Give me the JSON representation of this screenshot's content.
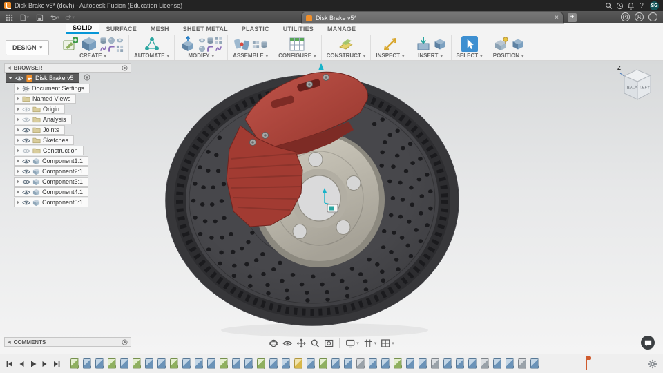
{
  "title_bar": {
    "title": "Disk Brake v5* (dcvh) - Autodesk Fusion (Education License)",
    "avatar_initials": "SG"
  },
  "tab_bar": {
    "document_tab": "Disk Brake v5*",
    "new_tab_label": "+",
    "close_label": "×"
  },
  "ribbon": {
    "workspace_label": "DESIGN",
    "active_tab": "SOLID",
    "tabs": [
      "SOLID",
      "SURFACE",
      "MESH",
      "SHEET METAL",
      "PLASTIC",
      "UTILITIES",
      "MANAGE"
    ],
    "groups": [
      "CREATE",
      "AUTOMATE",
      "MODIFY",
      "ASSEMBLE",
      "CONFIGURE",
      "CONSTRUCT",
      "INSPECT",
      "INSERT",
      "SELECT",
      "POSITION"
    ]
  },
  "browser": {
    "header": "BROWSER",
    "root_label": "Disk Brake v5",
    "items": [
      {
        "label": "Document Settings",
        "icon": "gear",
        "eye": "none"
      },
      {
        "label": "Named Views",
        "icon": "folder",
        "eye": "none"
      },
      {
        "label": "Origin",
        "icon": "folder",
        "eye": "off"
      },
      {
        "label": "Analysis",
        "icon": "folder",
        "eye": "off"
      },
      {
        "label": "Joints",
        "icon": "folder",
        "eye": "on"
      },
      {
        "label": "Sketches",
        "icon": "folder",
        "eye": "on"
      },
      {
        "label": "Construction",
        "icon": "folder",
        "eye": "off"
      },
      {
        "label": "Component1:1",
        "icon": "component",
        "eye": "on"
      },
      {
        "label": "Component2:1",
        "icon": "component",
        "eye": "on"
      },
      {
        "label": "Component3:1",
        "icon": "component",
        "eye": "on"
      },
      {
        "label": "Component4:1",
        "icon": "component",
        "eye": "on"
      },
      {
        "label": "Component5:1",
        "icon": "component",
        "eye": "on"
      }
    ]
  },
  "viewcube": {
    "visible_faces": [
      "BACK",
      "LEFT"
    ],
    "axis_label": "Z"
  },
  "comments_panel": {
    "header": "COMMENTS"
  },
  "timeline": {
    "features": [
      "sketch",
      "feature",
      "feature",
      "sketch",
      "feature",
      "sketch",
      "feature",
      "feature",
      "sketch",
      "feature",
      "feature",
      "feature",
      "sketch",
      "feature",
      "feature",
      "sketch",
      "feature",
      "feature",
      "plane",
      "feature",
      "sketch",
      "feature",
      "feature",
      "joint",
      "feature",
      "feature",
      "sketch",
      "feature",
      "feature",
      "joint",
      "feature",
      "feature",
      "feature",
      "joint",
      "feature",
      "feature",
      "joint",
      "feature"
    ]
  },
  "model": {
    "name": "Disk Brake v5",
    "caliper_color": "#a93c33",
    "rotor_color": "#3a3a3d",
    "hub_color": "#c2beb1",
    "accent_color": "#0696d7"
  }
}
